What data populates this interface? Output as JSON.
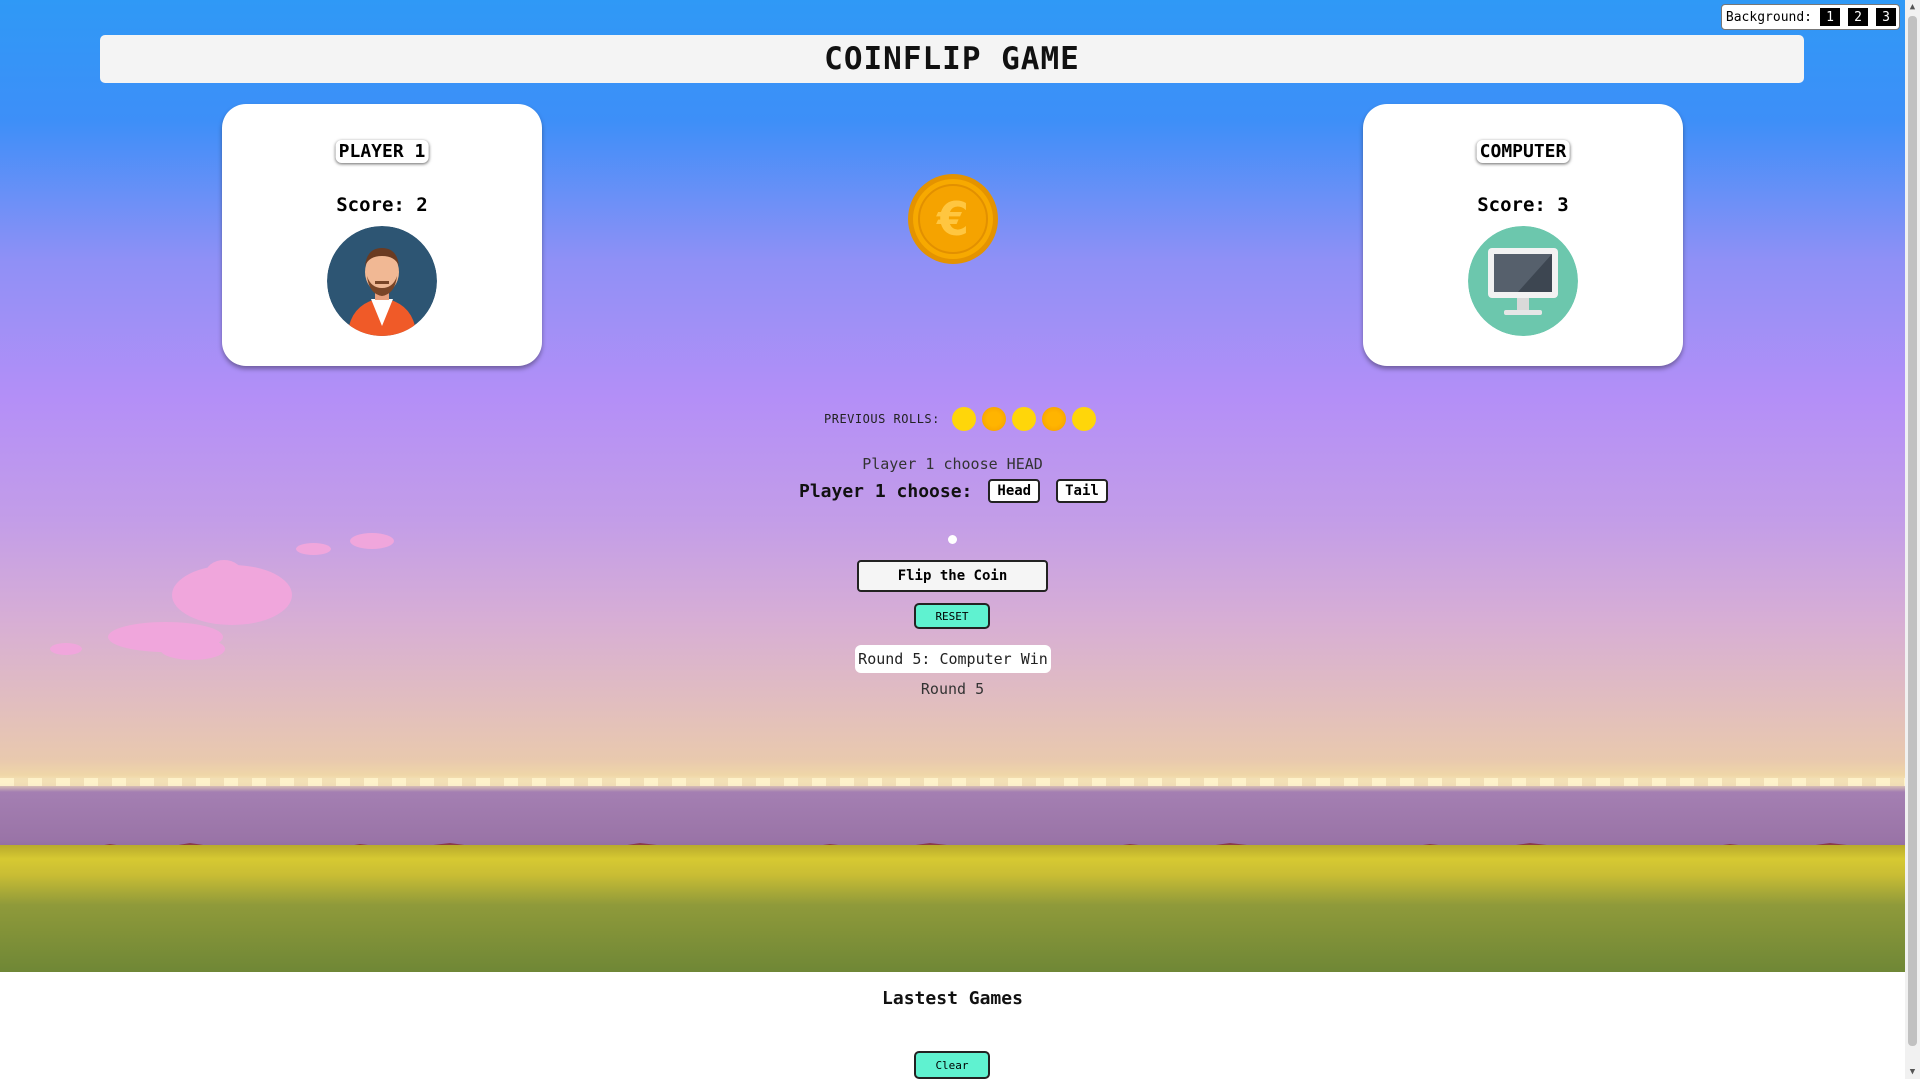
{
  "title": "COINFLIP GAME",
  "background_switcher": {
    "label": "Background:",
    "options": [
      "1",
      "2",
      "3"
    ]
  },
  "players": {
    "player": {
      "name": "PLAYER 1",
      "score": "Score: 2",
      "avatar": "man-avatar-icon"
    },
    "computer": {
      "name": "COMPUTER",
      "score": "Score: 3",
      "avatar": "monitor-avatar-icon"
    }
  },
  "coin": {
    "icon": "euro-coin-icon"
  },
  "previous_rolls": {
    "label": "PREVIOUS ROLLS:",
    "rolls": [
      "head",
      "tail",
      "head",
      "tail",
      "head"
    ]
  },
  "choice": {
    "status": "Player 1 choose HEAD",
    "prompt": "Player 1 choose:",
    "head_label": "Head",
    "tail_label": "Tail"
  },
  "actions": {
    "flip_label": "Flip the Coin",
    "reset_label": "RESET"
  },
  "result": {
    "round_result": "Round 5: Computer Win",
    "round": "Round 5"
  },
  "latest_games": {
    "title": "Lastest Games",
    "clear_label": "Clear"
  },
  "colors": {
    "accent_teal": "#5ff2d0",
    "coin_gold": "#f5a300",
    "sky_top": "#2f99f6",
    "sky_mid": "#b48ff7"
  }
}
